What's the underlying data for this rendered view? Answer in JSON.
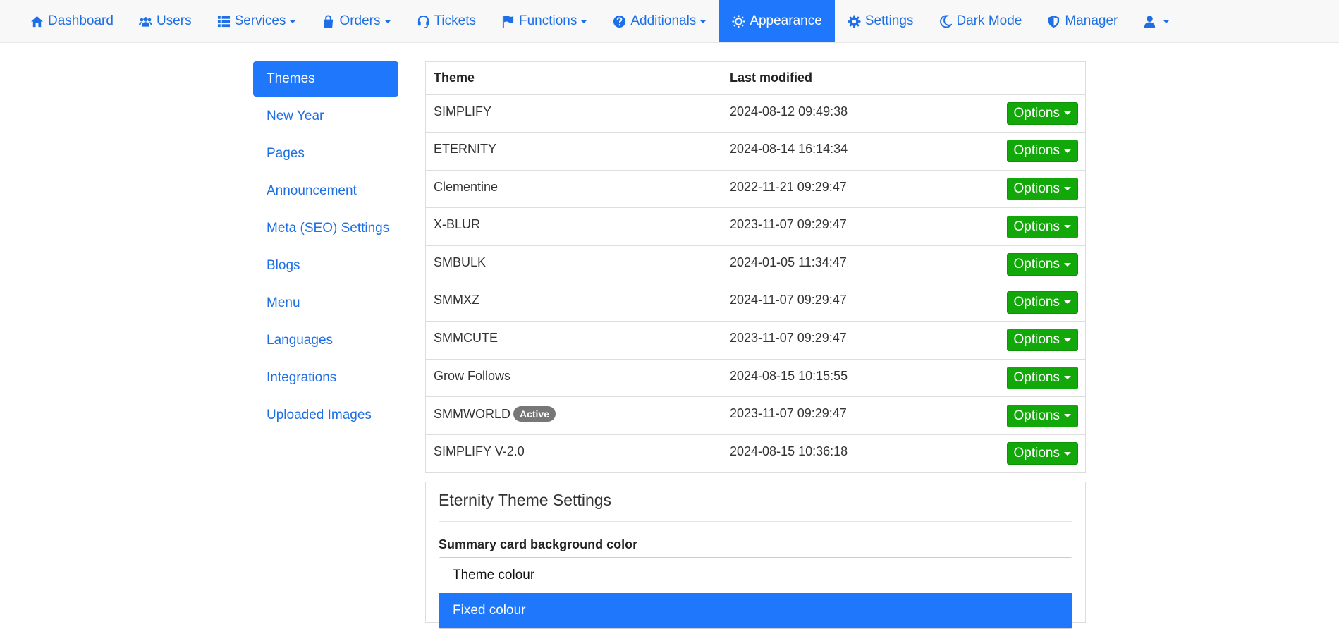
{
  "nav": {
    "items": [
      {
        "label": "Dashboard",
        "icon": "home-icon",
        "dropdown": false
      },
      {
        "label": "Users",
        "icon": "users-icon",
        "dropdown": false
      },
      {
        "label": "Services",
        "icon": "list-icon",
        "dropdown": true
      },
      {
        "label": "Orders",
        "icon": "shopping-bag-icon",
        "dropdown": true
      },
      {
        "label": "Tickets",
        "icon": "headset-icon",
        "dropdown": false
      },
      {
        "label": "Functions",
        "icon": "flag-icon",
        "dropdown": true
      },
      {
        "label": "Additionals",
        "icon": "question-circle-icon",
        "dropdown": true
      },
      {
        "label": "Appearance",
        "icon": "sun-icon",
        "dropdown": false,
        "active": true
      },
      {
        "label": "Settings",
        "icon": "gear-icon",
        "dropdown": false
      },
      {
        "label": "Dark Mode",
        "icon": "moon-icon",
        "dropdown": false
      },
      {
        "label": "Manager",
        "icon": "shield-icon",
        "dropdown": false
      }
    ],
    "user_icon": "user-icon"
  },
  "sidebar": {
    "items": [
      {
        "label": "Themes",
        "active": true
      },
      {
        "label": "New Year"
      },
      {
        "label": "Pages"
      },
      {
        "label": "Announcement"
      },
      {
        "label": "Meta (SEO) Settings"
      },
      {
        "label": "Blogs"
      },
      {
        "label": "Menu"
      },
      {
        "label": "Languages"
      },
      {
        "label": "Integrations"
      },
      {
        "label": "Uploaded Images"
      }
    ]
  },
  "themes_table": {
    "headers": {
      "theme": "Theme",
      "modified": "Last modified"
    },
    "options_label": "Options",
    "active_badge": "Active",
    "rows": [
      {
        "name": "SIMPLIFY",
        "modified": "2024-08-12 09:49:38",
        "active": false
      },
      {
        "name": "ETERNITY",
        "modified": "2024-08-14 16:14:34",
        "active": false
      },
      {
        "name": "Clementine",
        "modified": "2022-11-21 09:29:47",
        "active": false
      },
      {
        "name": "X-BLUR",
        "modified": "2023-11-07 09:29:47",
        "active": false
      },
      {
        "name": "SMBULK",
        "modified": "2024-01-05 11:34:47",
        "active": false
      },
      {
        "name": "SMMXZ",
        "modified": "2024-11-07 09:29:47",
        "active": false
      },
      {
        "name": "SMMCUTE",
        "modified": "2023-11-07 09:29:47",
        "active": false
      },
      {
        "name": "Grow Follows",
        "modified": "2024-08-15 10:15:55",
        "active": false
      },
      {
        "name": "SMMWORLD",
        "modified": "2023-11-07 09:29:47",
        "active": true
      },
      {
        "name": "SIMPLIFY V-2.0",
        "modified": "2024-08-15 10:36:18",
        "active": false
      }
    ]
  },
  "settings_panel": {
    "title": "Eternity Theme Settings",
    "field_label": "Summary card background color",
    "options": [
      {
        "label": "Theme colour",
        "selected": false
      },
      {
        "label": "Fixed colour",
        "selected": true
      }
    ]
  },
  "colors": {
    "link": "#1e6fe6",
    "primary": "#1f78fb",
    "success": "#13a809",
    "badge": "#777777"
  }
}
